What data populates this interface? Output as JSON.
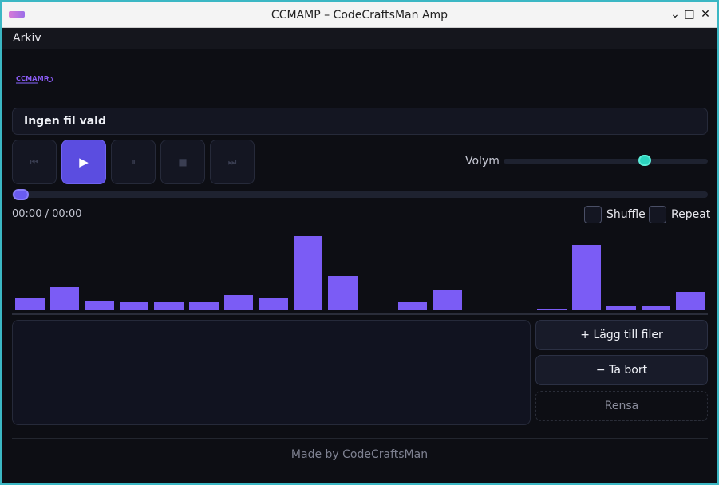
{
  "window": {
    "title": "CCMAMP – CodeCraftsMan Amp",
    "minimize_glyph": "⌄",
    "maximize_glyph": "□",
    "close_glyph": "✕"
  },
  "menu": {
    "items": [
      {
        "label": "Arkiv"
      }
    ]
  },
  "logo": {
    "text": "CCMAMP"
  },
  "now_playing": {
    "label": "Ingen fil vald"
  },
  "controls": {
    "previous_icon": "previous-icon",
    "previous_glyph": "⏮",
    "play_icon": "play-icon",
    "play_glyph": "▶",
    "pause_icon": "pause-icon",
    "pause_glyph": "⏸",
    "stop_icon": "stop-icon",
    "stop_glyph": "■",
    "next_icon": "next-icon",
    "next_glyph": "⏭"
  },
  "volume": {
    "label": "Volym",
    "level": 0.69
  },
  "seek": {
    "position": 0.0
  },
  "time": {
    "text": "00:00 / 00:00"
  },
  "options": {
    "shuffle_label": "Shuffle",
    "shuffle_checked": false,
    "repeat_label": "Repeat",
    "repeat_checked": false
  },
  "visualizer": {
    "color": "#7b5cf5",
    "levels": [
      0.14,
      0.29,
      0.11,
      0.1,
      0.09,
      0.09,
      0.18,
      0.14,
      0.94,
      0.43,
      0.0,
      0.1,
      0.25,
      0.0,
      0.0,
      0.01,
      0.83,
      0.04,
      0.04,
      0.22
    ]
  },
  "playlist": {
    "items": []
  },
  "actions": {
    "add_label": "+ Lägg till filer",
    "remove_label": "− Ta bort",
    "clear_label": "Rensa"
  },
  "footer": {
    "text": "Made by CodeCraftsMan"
  },
  "colors": {
    "accent": "#5b4de0",
    "volume_accent": "#2dd4bf",
    "background": "#0d0e14"
  }
}
